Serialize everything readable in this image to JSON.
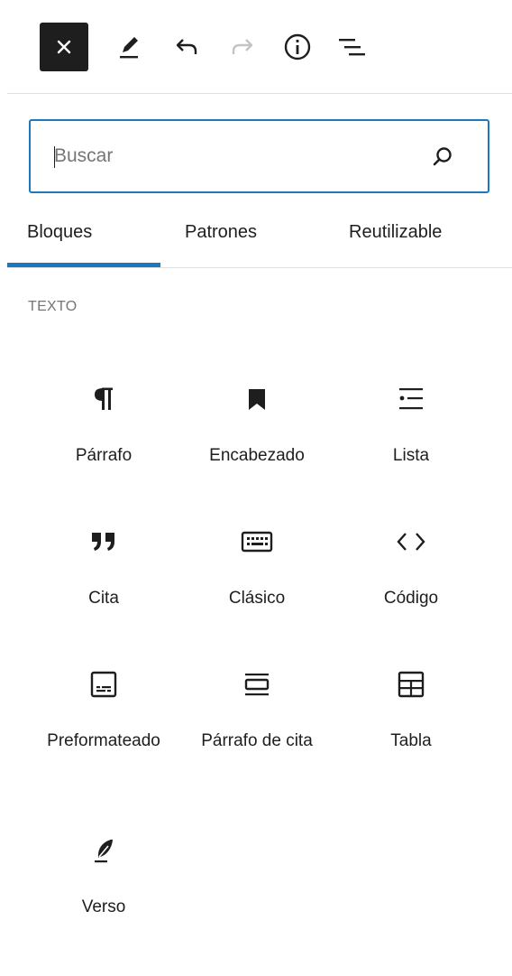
{
  "toolbar": {
    "close_icon": "close-icon",
    "edit_icon": "pencil-icon",
    "undo_icon": "undo-icon",
    "redo_icon": "redo-icon",
    "info_icon": "info-icon",
    "list_view_icon": "list-view-icon"
  },
  "search": {
    "placeholder": "Buscar",
    "value": ""
  },
  "tabs": [
    {
      "label": "Bloques",
      "active": true
    },
    {
      "label": "Patrones",
      "active": false
    },
    {
      "label": "Reutilizable",
      "active": false
    }
  ],
  "section": {
    "title": "TEXTO"
  },
  "blocks": [
    {
      "label": "Párrafo",
      "icon": "paragraph-icon"
    },
    {
      "label": "Encabezado",
      "icon": "bookmark-icon"
    },
    {
      "label": "Lista",
      "icon": "list-icon"
    },
    {
      "label": "Cita",
      "icon": "quote-icon"
    },
    {
      "label": "Clásico",
      "icon": "keyboard-icon"
    },
    {
      "label": "Código",
      "icon": "code-icon"
    },
    {
      "label": "Preformateado",
      "icon": "preformatted-icon"
    },
    {
      "label": "Párrafo de cita",
      "icon": "pullquote-icon"
    },
    {
      "label": "Tabla",
      "icon": "table-icon"
    },
    {
      "label": "Verso",
      "icon": "verse-icon"
    }
  ],
  "colors": {
    "accent": "#1e78bd",
    "text": "#1e1e1e",
    "muted": "#757575",
    "close_bg": "#1e1e1e"
  }
}
